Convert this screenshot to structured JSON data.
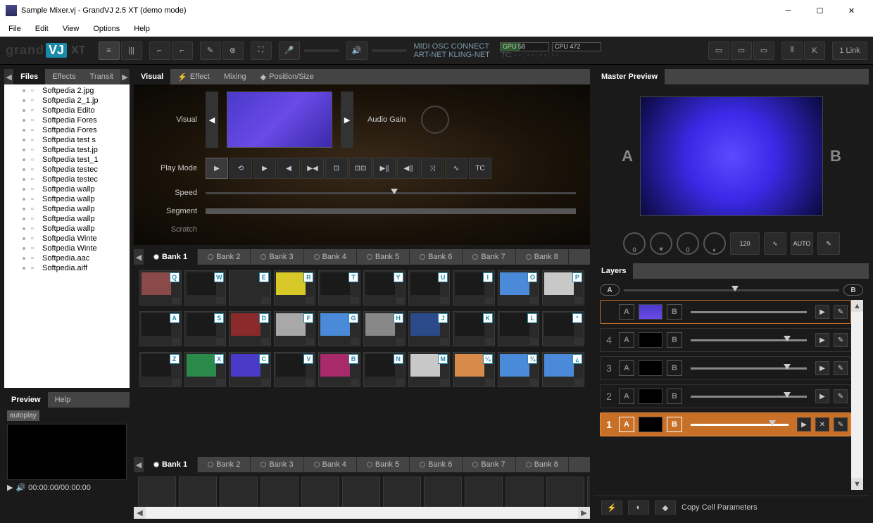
{
  "window": {
    "title": "Sample Mixer.vj - GrandVJ 2.5 XT (demo mode)"
  },
  "menu": [
    "File",
    "Edit",
    "View",
    "Options",
    "Help"
  ],
  "logo": {
    "brand": "grand",
    "suffix": "VJ",
    "ext": "XT"
  },
  "toolbar_status": {
    "row1": "MIDI  OSC  CONNECT",
    "row2": "ART-NET  KLING-NET"
  },
  "meters": {
    "gpu": "GPU 58",
    "cpu": "CPU 472",
    "tc": "TC: - - : - - : - - : - -"
  },
  "link_btn": "1 Link",
  "browser": {
    "tabs": [
      "Files",
      "Effects",
      "Transit"
    ],
    "active": 0,
    "files": [
      "Softpedia 2.jpg",
      "Softpedia 2_1.jp",
      "Softpedia Edito",
      "Softpedia Fores",
      "Softpedia Fores",
      "Softpedia test s",
      "Softpedia test.jp",
      "Softpedia test_1",
      "Softpedia testec",
      "Softpedia testec",
      "Softpedia wallp",
      "Softpedia wallp",
      "Softpedia wallp",
      "Softpedia wallp",
      "Softpedia wallp",
      "Softpedia Winte",
      "Softpedia Winte",
      "Softpedia.aac",
      "Softpedia.aiff"
    ]
  },
  "preview_panel": {
    "tabs": [
      "Preview",
      "Help"
    ],
    "autoplay": "autoplay",
    "time": "00:00:00/00:00:00"
  },
  "visual_tabs": [
    "Visual",
    "Effect",
    "Mixing",
    "Position/Size"
  ],
  "visual": {
    "visual_label": "Visual",
    "audio_gain": "Audio Gain",
    "play_mode": "Play Mode",
    "speed": "Speed",
    "segment": "Segment",
    "scratch": "Scratch",
    "pm_buttons": [
      "▶",
      "⟲",
      "▶",
      "◀",
      "▶◀",
      "⊡",
      "⊡⊡",
      "▶||",
      "◀||",
      "⤨",
      "∿",
      "TC"
    ]
  },
  "banks": [
    "Bank 1",
    "Bank 2",
    "Bank 3",
    "Bank 4",
    "Bank 5",
    "Bank 6",
    "Bank 7",
    "Bank 8"
  ],
  "clip_rows": [
    {
      "keys": [
        "Q",
        "W",
        "E",
        "R",
        "T",
        "Y",
        "U",
        "I",
        "O",
        "P"
      ],
      "colors": [
        "#8a4a4a",
        "#1a1a1a",
        "#2a2a2a",
        "#d8c828",
        "#1a1a1a",
        "#1a1a1a",
        "#1a1a1a",
        "#1a1a1a",
        "#4a8ad8",
        "#c8c8c8"
      ]
    },
    {
      "keys": [
        "A",
        "S",
        "D",
        "F",
        "G",
        "H",
        "J",
        "K",
        "L",
        "°"
      ],
      "colors": [
        "#1a1a1a",
        "#1a1a1a",
        "#8a2a2a",
        "#a8a8a8",
        "#4a8ad8",
        "#888",
        "#2a4a8a",
        "#1a1a1a",
        "#1a1a1a",
        "#1a1a1a"
      ]
    },
    {
      "keys": [
        "Z",
        "X",
        "C",
        "V",
        "B",
        "N",
        "M",
        "¼",
        "¾",
        "¿"
      ],
      "colors": [
        "#1a1a1a",
        "#2a8a4a",
        "#4a3ac8",
        "#1a1a1a",
        "#a82a6a",
        "#1a1a1a",
        "#c8c8c8",
        "#d88a4a",
        "#4a8ad8",
        "#4a8ad8"
      ]
    }
  ],
  "master": {
    "title": "Master Preview",
    "a": "A",
    "b": "B",
    "bpm": "120",
    "auto": "AUTO"
  },
  "layers": {
    "title": "Layers",
    "rows": [
      {
        "num": "4",
        "active": false
      },
      {
        "num": "3",
        "active": false
      },
      {
        "num": "2",
        "active": false
      },
      {
        "num": "1",
        "active": true
      }
    ],
    "footer_text": "Copy Cell Parameters"
  }
}
